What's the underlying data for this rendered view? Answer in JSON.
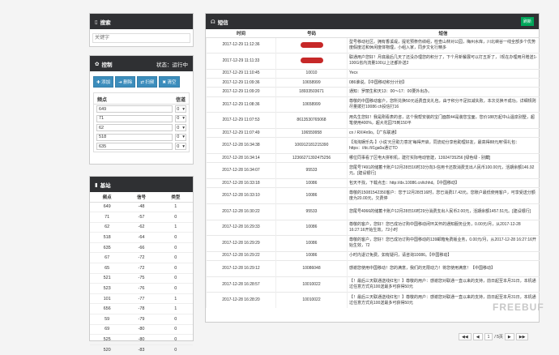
{
  "search": {
    "title": "搜索",
    "placeholder": "关键字"
  },
  "control": {
    "title": "控制",
    "status": "状态：运行中",
    "buttons": [
      "✚ 添加",
      "➜ 删除",
      "⇄ 扫频",
      "✖ 清空"
    ],
    "col_freq": "频点",
    "col_channel": "信道",
    "rows": [
      {
        "freq": "649",
        "channel": "0"
      },
      {
        "freq": "71",
        "channel": "0"
      },
      {
        "freq": "62",
        "channel": "0"
      },
      {
        "freq": "518",
        "channel": "0"
      },
      {
        "freq": "635",
        "channel": "0"
      }
    ]
  },
  "baseband": {
    "title": "基站",
    "headers": [
      "频点",
      "信号",
      "类型"
    ],
    "rows": [
      [
        "649",
        "-48",
        "1"
      ],
      [
        "71",
        "-57",
        "0"
      ],
      [
        "62",
        "-62",
        "1"
      ],
      [
        "518",
        "-64",
        "0"
      ],
      [
        "635",
        "-66",
        "0"
      ],
      [
        "67",
        "-72",
        "0"
      ],
      [
        "65",
        "-72",
        "0"
      ],
      [
        "521",
        "-75",
        "0"
      ],
      [
        "523",
        "-76",
        "0"
      ],
      [
        "101",
        "-77",
        "1"
      ],
      [
        "656",
        "-78",
        "1"
      ],
      [
        "59",
        "-79",
        "0"
      ],
      [
        "69",
        "-80",
        "0"
      ],
      [
        "525",
        "-80",
        "0"
      ],
      [
        "520",
        "-83",
        "0"
      ]
    ]
  },
  "sms": {
    "title": "短信",
    "refresh": "刷新",
    "headers": [
      "时间",
      "号码",
      "短信"
    ],
    "rows": [
      {
        "time": "2017-12-29 11:12:36",
        "number": "",
        "redacted": true,
        "text": "型号移动社区。拥有香溪堤，提花预祭伤绩组，检查山林对公园，梅州水库，川北峡谷一线全部多个优势度假度过和休闲度体物理，小组入家，同步文化行精多",
        "tall": true
      },
      {
        "time": "2017-12-29 11:11:33",
        "number": "",
        "redacted": true,
        "text": "联通用户您好！月底最后几天了还没办理您的积分了，下个月新餐展可以打五折了，（现在办理用月赠送1-100G省内流量100以上还都外送2",
        "tall": true
      },
      {
        "time": "2017-12-29 11:10:45",
        "number": "10010",
        "text": "Yecx",
        "tall": false
      },
      {
        "time": "2017-12-29 11:09:36",
        "number": "10658999",
        "text": "086谁说。【中国移动积分计划】",
        "tall": false
      },
      {
        "time": "2017-12-29 11:09:20",
        "number": "18933503671",
        "text": "通知：罗丽生和天13：00～17：00要外出办。",
        "tall": false
      },
      {
        "time": "2017-12-29 11:08:36",
        "number": "10658999",
        "text": "尊敬的中国移动客户，您所兑换50元话费直充礼包，由于积分不足扣减失败，本次兑换不成功。详细规则尽量拨打10086 ch投信打16",
        "tall": true
      },
      {
        "time": "2017-12-29 11:07:53",
        "number": "8613530765068",
        "text": "用先生您好！我是刚看表的咨，这个我帮安装的宝门面款44是装您宝面，您价188万起中山温泉别墅，超笔使用400%，超大花园75到150平",
        "tall": true
      },
      {
        "time": "2017-12-29 11:07:49",
        "number": "106559958",
        "text": "cn / RXI4n9o。【广东联通】",
        "tall": false
      },
      {
        "time": "2017-12-28 16:34:38",
        "number": "106912181215390",
        "text": "【淘淘娱乐先·】小说'元旦助力意定'每得开启，同流动分享他助理好友，最高得88元用'倩礼包：https：//dc.fi/1ga0a通订TD",
        "tall": true
      },
      {
        "time": "2017-12-28 16:34:14",
        "number": "12366271392475256",
        "text": "哪位同事看了区电大拼积机，建打实际电动管建，13924735256 [绿色绿 - 别藏]",
        "tall": false
      },
      {
        "time": "2017-12-28 16:34:07",
        "number": "95533",
        "text": "您尾号7491的储蓄卡账户12月28日16时33分向3-信用卡还款消费支出人民币100.00元，活期余额146.92元。[建设银行]",
        "tall": true
      },
      {
        "time": "2017-12-28 16:33:18",
        "number": "10086",
        "text": "包天不找，下载点击：http://dx.10086.cn/tchhd。【中国移动】",
        "tall": false
      },
      {
        "time": "2017-12-28 16:33:10",
        "number": "10086",
        "text": "尊敬的15081542350客户：您于12月28日16时，您已消费17.43元。您账户最低使用客户，可享受送分额度为20.00元，欠费停",
        "tall": true
      },
      {
        "time": "2017-12-28 16:30:22",
        "number": "95533",
        "text": "您尾号4066的储蓄卡账户12月28日16时29分消费支出人民币2.00元，活期余额1457.51元。[建设银行]",
        "tall": true
      },
      {
        "time": "2017-12-28 16:29:33",
        "number": "10086",
        "text": "尊敬的客户，您好！您已成功订购中国移动闭环关怀的通知服务业务，0.00元/月，从2017-12-28 16:27:16开始生效，72小时",
        "tall": true
      },
      {
        "time": "2017-12-28 16:29:29",
        "number": "10086",
        "text": "尊敬的客户，您好！您已成功订购中国移动的139邮箱免费版业务，0.00元/月，从2017-12-28 16:27:16开始生效，72",
        "tall": true
      },
      {
        "time": "2017-12-28 16:29:22",
        "number": "10086",
        "text": "小时内退订免费。如有疑问，请咨询10086。【中国移动】",
        "tall": false
      },
      {
        "time": "2017-12-28 16:29:12",
        "number": "10086048",
        "text": "感谢您使用中国移动！您的满意，我们的无限动力！将您使用满意！【中国移动】",
        "tall": true
      },
      {
        "time": "2017-12-28 16:28:57",
        "number": "10010022",
        "text": "【！最后三天联通送线红包！】尊敬的用户：感谢您对联通一直以来的支持，前日起至本月31日，本机通过任意方式充100送最多可获得50元",
        "tall": true
      },
      {
        "time": "2017-12-28 16:28:20",
        "number": "10010022",
        "text": "【！最后三天联通送线红包！】尊敬的用户：感谢您对联通一直以来的支持，前日起至本月31日，本机通过任意方式充100送最多可获得50元",
        "tall": true
      }
    ]
  },
  "pager": {
    "first": "◀◀",
    "prev": "◀",
    "current": "1",
    "total": "/ 5页",
    "next": "▶",
    "last": "▶▶"
  },
  "watermark": "FREEBUF"
}
